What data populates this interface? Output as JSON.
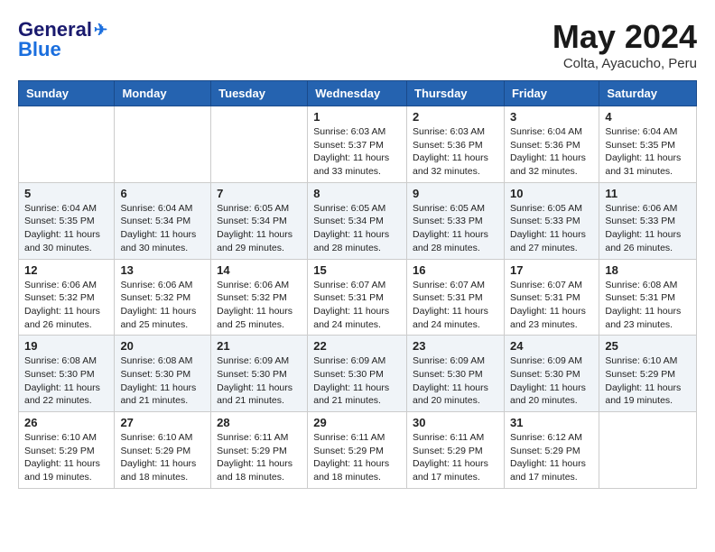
{
  "header": {
    "logo_general": "General",
    "logo_blue": "Blue",
    "month_year": "May 2024",
    "location": "Colta, Ayacucho, Peru"
  },
  "days_of_week": [
    "Sunday",
    "Monday",
    "Tuesday",
    "Wednesday",
    "Thursday",
    "Friday",
    "Saturday"
  ],
  "weeks": [
    [
      {
        "day": "",
        "info": ""
      },
      {
        "day": "",
        "info": ""
      },
      {
        "day": "",
        "info": ""
      },
      {
        "day": "1",
        "info": "Sunrise: 6:03 AM\nSunset: 5:37 PM\nDaylight: 11 hours and 33 minutes."
      },
      {
        "day": "2",
        "info": "Sunrise: 6:03 AM\nSunset: 5:36 PM\nDaylight: 11 hours and 32 minutes."
      },
      {
        "day": "3",
        "info": "Sunrise: 6:04 AM\nSunset: 5:36 PM\nDaylight: 11 hours and 32 minutes."
      },
      {
        "day": "4",
        "info": "Sunrise: 6:04 AM\nSunset: 5:35 PM\nDaylight: 11 hours and 31 minutes."
      }
    ],
    [
      {
        "day": "5",
        "info": "Sunrise: 6:04 AM\nSunset: 5:35 PM\nDaylight: 11 hours and 30 minutes."
      },
      {
        "day": "6",
        "info": "Sunrise: 6:04 AM\nSunset: 5:34 PM\nDaylight: 11 hours and 30 minutes."
      },
      {
        "day": "7",
        "info": "Sunrise: 6:05 AM\nSunset: 5:34 PM\nDaylight: 11 hours and 29 minutes."
      },
      {
        "day": "8",
        "info": "Sunrise: 6:05 AM\nSunset: 5:34 PM\nDaylight: 11 hours and 28 minutes."
      },
      {
        "day": "9",
        "info": "Sunrise: 6:05 AM\nSunset: 5:33 PM\nDaylight: 11 hours and 28 minutes."
      },
      {
        "day": "10",
        "info": "Sunrise: 6:05 AM\nSunset: 5:33 PM\nDaylight: 11 hours and 27 minutes."
      },
      {
        "day": "11",
        "info": "Sunrise: 6:06 AM\nSunset: 5:33 PM\nDaylight: 11 hours and 26 minutes."
      }
    ],
    [
      {
        "day": "12",
        "info": "Sunrise: 6:06 AM\nSunset: 5:32 PM\nDaylight: 11 hours and 26 minutes."
      },
      {
        "day": "13",
        "info": "Sunrise: 6:06 AM\nSunset: 5:32 PM\nDaylight: 11 hours and 25 minutes."
      },
      {
        "day": "14",
        "info": "Sunrise: 6:06 AM\nSunset: 5:32 PM\nDaylight: 11 hours and 25 minutes."
      },
      {
        "day": "15",
        "info": "Sunrise: 6:07 AM\nSunset: 5:31 PM\nDaylight: 11 hours and 24 minutes."
      },
      {
        "day": "16",
        "info": "Sunrise: 6:07 AM\nSunset: 5:31 PM\nDaylight: 11 hours and 24 minutes."
      },
      {
        "day": "17",
        "info": "Sunrise: 6:07 AM\nSunset: 5:31 PM\nDaylight: 11 hours and 23 minutes."
      },
      {
        "day": "18",
        "info": "Sunrise: 6:08 AM\nSunset: 5:31 PM\nDaylight: 11 hours and 23 minutes."
      }
    ],
    [
      {
        "day": "19",
        "info": "Sunrise: 6:08 AM\nSunset: 5:30 PM\nDaylight: 11 hours and 22 minutes."
      },
      {
        "day": "20",
        "info": "Sunrise: 6:08 AM\nSunset: 5:30 PM\nDaylight: 11 hours and 21 minutes."
      },
      {
        "day": "21",
        "info": "Sunrise: 6:09 AM\nSunset: 5:30 PM\nDaylight: 11 hours and 21 minutes."
      },
      {
        "day": "22",
        "info": "Sunrise: 6:09 AM\nSunset: 5:30 PM\nDaylight: 11 hours and 21 minutes."
      },
      {
        "day": "23",
        "info": "Sunrise: 6:09 AM\nSunset: 5:30 PM\nDaylight: 11 hours and 20 minutes."
      },
      {
        "day": "24",
        "info": "Sunrise: 6:09 AM\nSunset: 5:30 PM\nDaylight: 11 hours and 20 minutes."
      },
      {
        "day": "25",
        "info": "Sunrise: 6:10 AM\nSunset: 5:29 PM\nDaylight: 11 hours and 19 minutes."
      }
    ],
    [
      {
        "day": "26",
        "info": "Sunrise: 6:10 AM\nSunset: 5:29 PM\nDaylight: 11 hours and 19 minutes."
      },
      {
        "day": "27",
        "info": "Sunrise: 6:10 AM\nSunset: 5:29 PM\nDaylight: 11 hours and 18 minutes."
      },
      {
        "day": "28",
        "info": "Sunrise: 6:11 AM\nSunset: 5:29 PM\nDaylight: 11 hours and 18 minutes."
      },
      {
        "day": "29",
        "info": "Sunrise: 6:11 AM\nSunset: 5:29 PM\nDaylight: 11 hours and 18 minutes."
      },
      {
        "day": "30",
        "info": "Sunrise: 6:11 AM\nSunset: 5:29 PM\nDaylight: 11 hours and 17 minutes."
      },
      {
        "day": "31",
        "info": "Sunrise: 6:12 AM\nSunset: 5:29 PM\nDaylight: 11 hours and 17 minutes."
      },
      {
        "day": "",
        "info": ""
      }
    ]
  ]
}
